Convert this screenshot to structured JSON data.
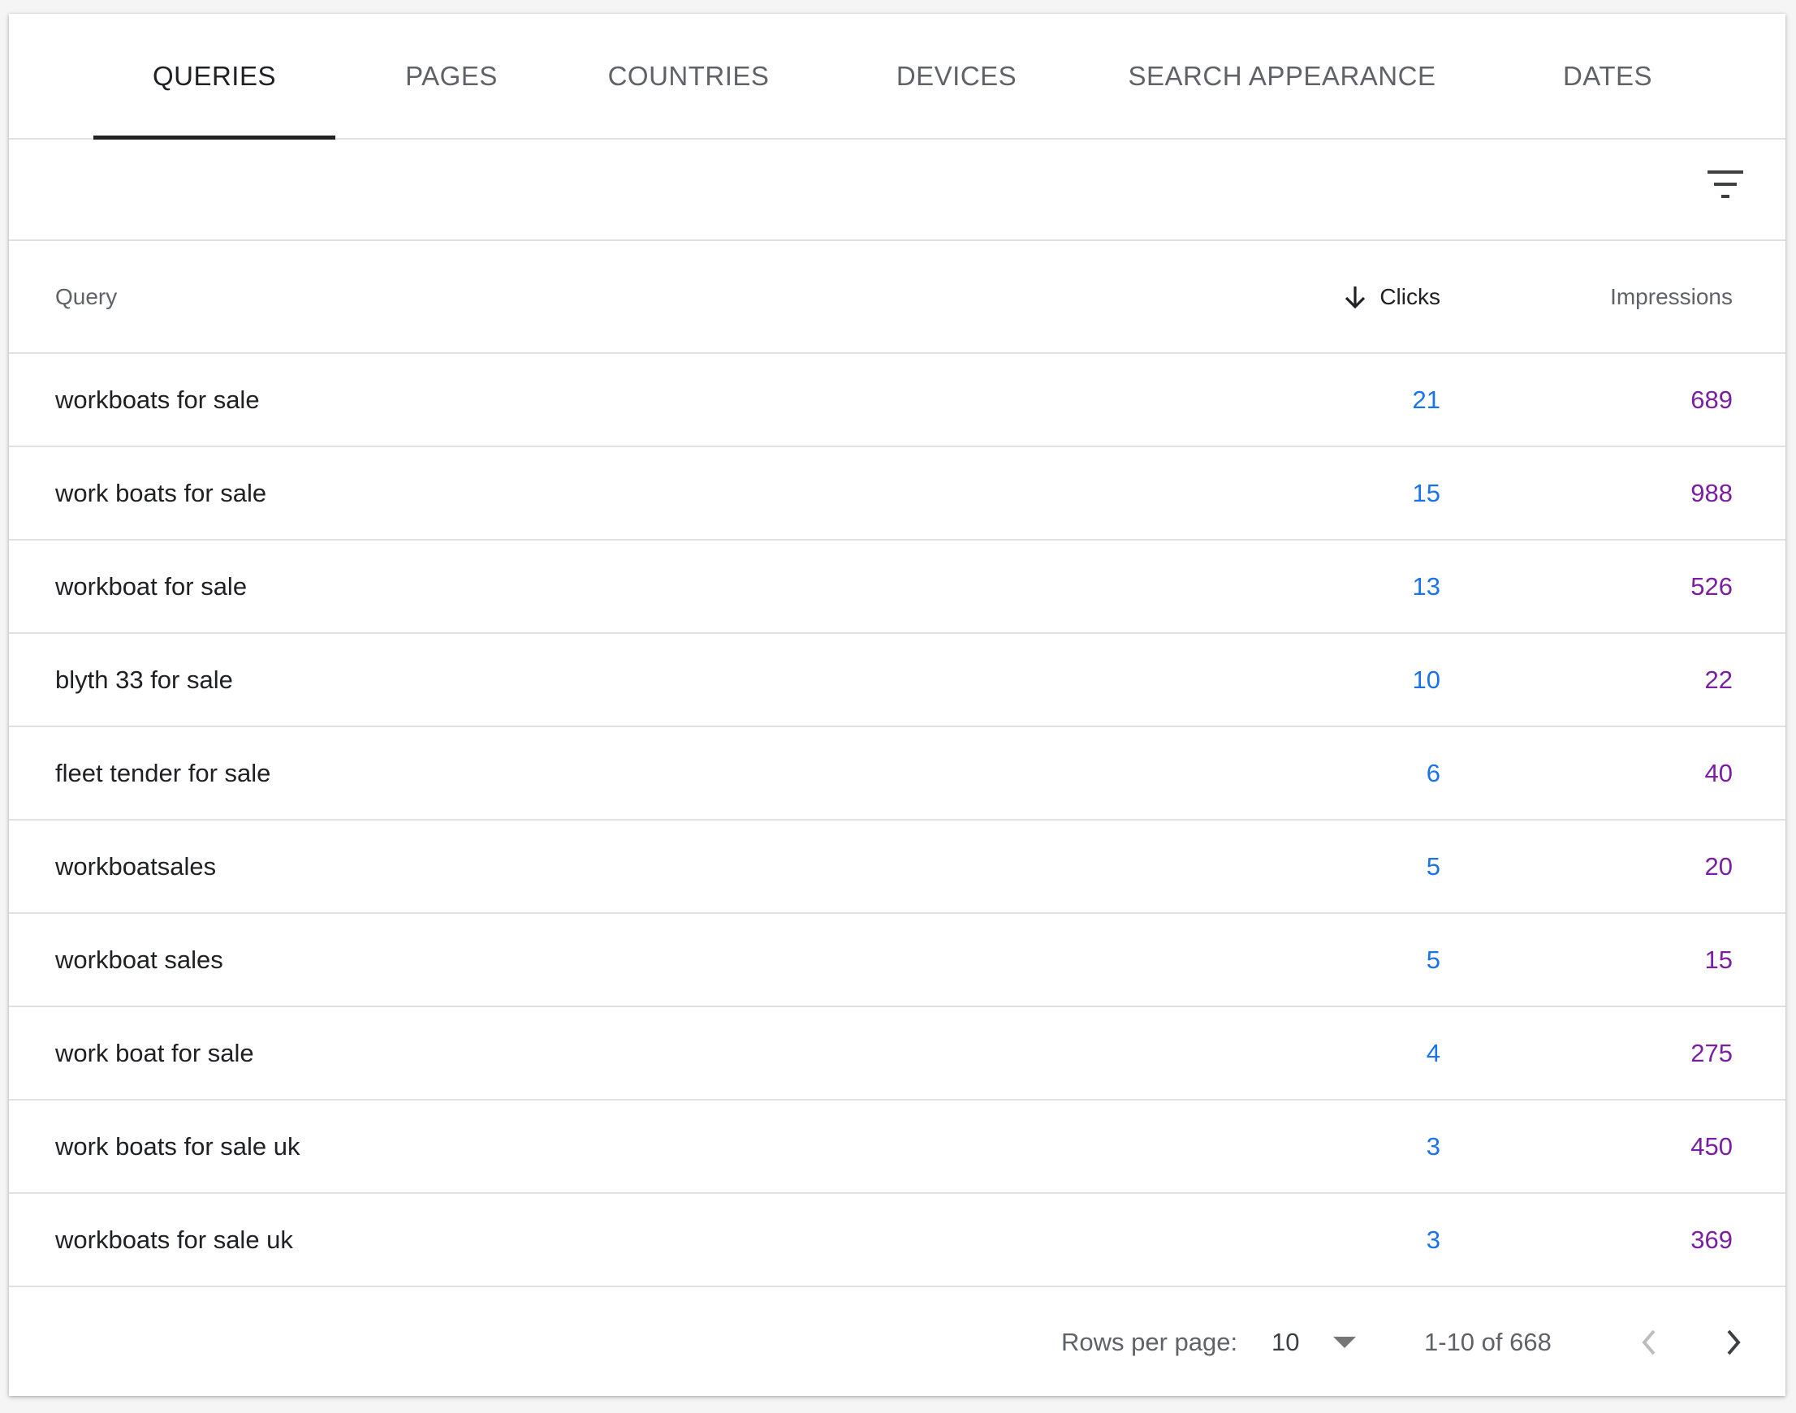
{
  "tabs": [
    {
      "label": "QUERIES",
      "active": true
    },
    {
      "label": "PAGES",
      "active": false
    },
    {
      "label": "COUNTRIES",
      "active": false
    },
    {
      "label": "DEVICES",
      "active": false
    },
    {
      "label": "SEARCH APPEARANCE",
      "active": false
    },
    {
      "label": "DATES",
      "active": false
    }
  ],
  "filter": {
    "icon": "filter-icon"
  },
  "table": {
    "headers": {
      "query": "Query",
      "clicks": "Clicks",
      "impressions": "Impressions",
      "sort_icon": "arrow-down-icon"
    },
    "rows": [
      {
        "query": "workboats for sale",
        "clicks": "21",
        "impressions": "689"
      },
      {
        "query": "work boats for sale",
        "clicks": "15",
        "impressions": "988"
      },
      {
        "query": "workboat for sale",
        "clicks": "13",
        "impressions": "526"
      },
      {
        "query": "blyth 33 for sale",
        "clicks": "10",
        "impressions": "22"
      },
      {
        "query": "fleet tender for sale",
        "clicks": "6",
        "impressions": "40"
      },
      {
        "query": "workboatsales",
        "clicks": "5",
        "impressions": "20"
      },
      {
        "query": "workboat sales",
        "clicks": "5",
        "impressions": "15"
      },
      {
        "query": "work boat for sale",
        "clicks": "4",
        "impressions": "275"
      },
      {
        "query": "work boats for sale uk",
        "clicks": "3",
        "impressions": "450"
      },
      {
        "query": "workboats for sale uk",
        "clicks": "3",
        "impressions": "369"
      }
    ]
  },
  "pagination": {
    "rows_per_page_label": "Rows per page:",
    "rows_per_page_value": "10",
    "range": "1-10 of 668"
  },
  "colors": {
    "clicks": "#1a73e8",
    "impressions": "#7b1fa2",
    "active_tab": "#202124"
  }
}
